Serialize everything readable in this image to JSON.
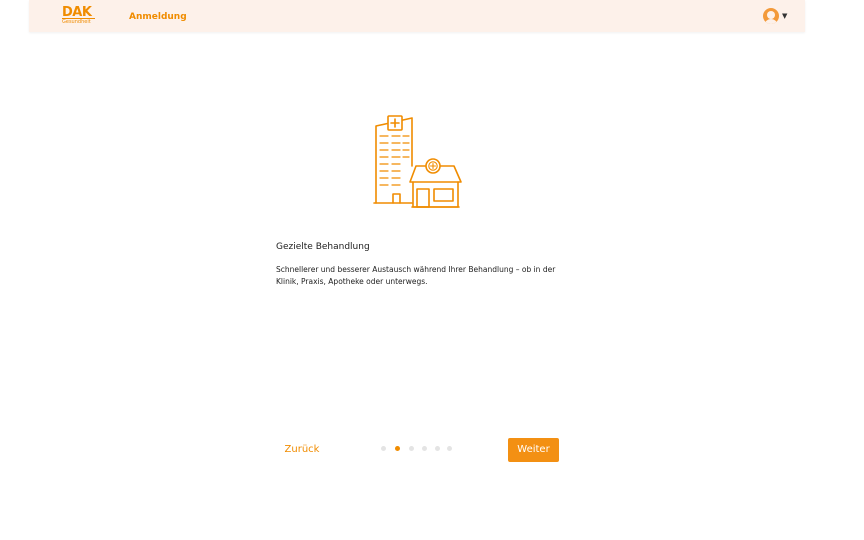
{
  "header": {
    "logo": {
      "name": "DAK",
      "sub": "Gesundheit"
    },
    "nav_label": "Anmeldung",
    "profile_icon": "user-avatar-icon",
    "profile_menu_icon": "chevron-down-icon"
  },
  "slide": {
    "illustration_icon": "hospital-and-pharmacy-icon",
    "title": "Gezielte Behandlung",
    "description": "Schnellerer und besserer Austausch während Ihrer Behandlung – ob in der Klinik, Praxis, Apotheke oder unterwegs."
  },
  "pager": {
    "back_label": "Zurück",
    "next_label": "Weiter",
    "total": 6,
    "current": 2
  },
  "colors": {
    "accent": "#f08c00",
    "button": "#f39013",
    "header_bg": "#fdf1ea",
    "dot_inactive": "#e4e4e4"
  }
}
